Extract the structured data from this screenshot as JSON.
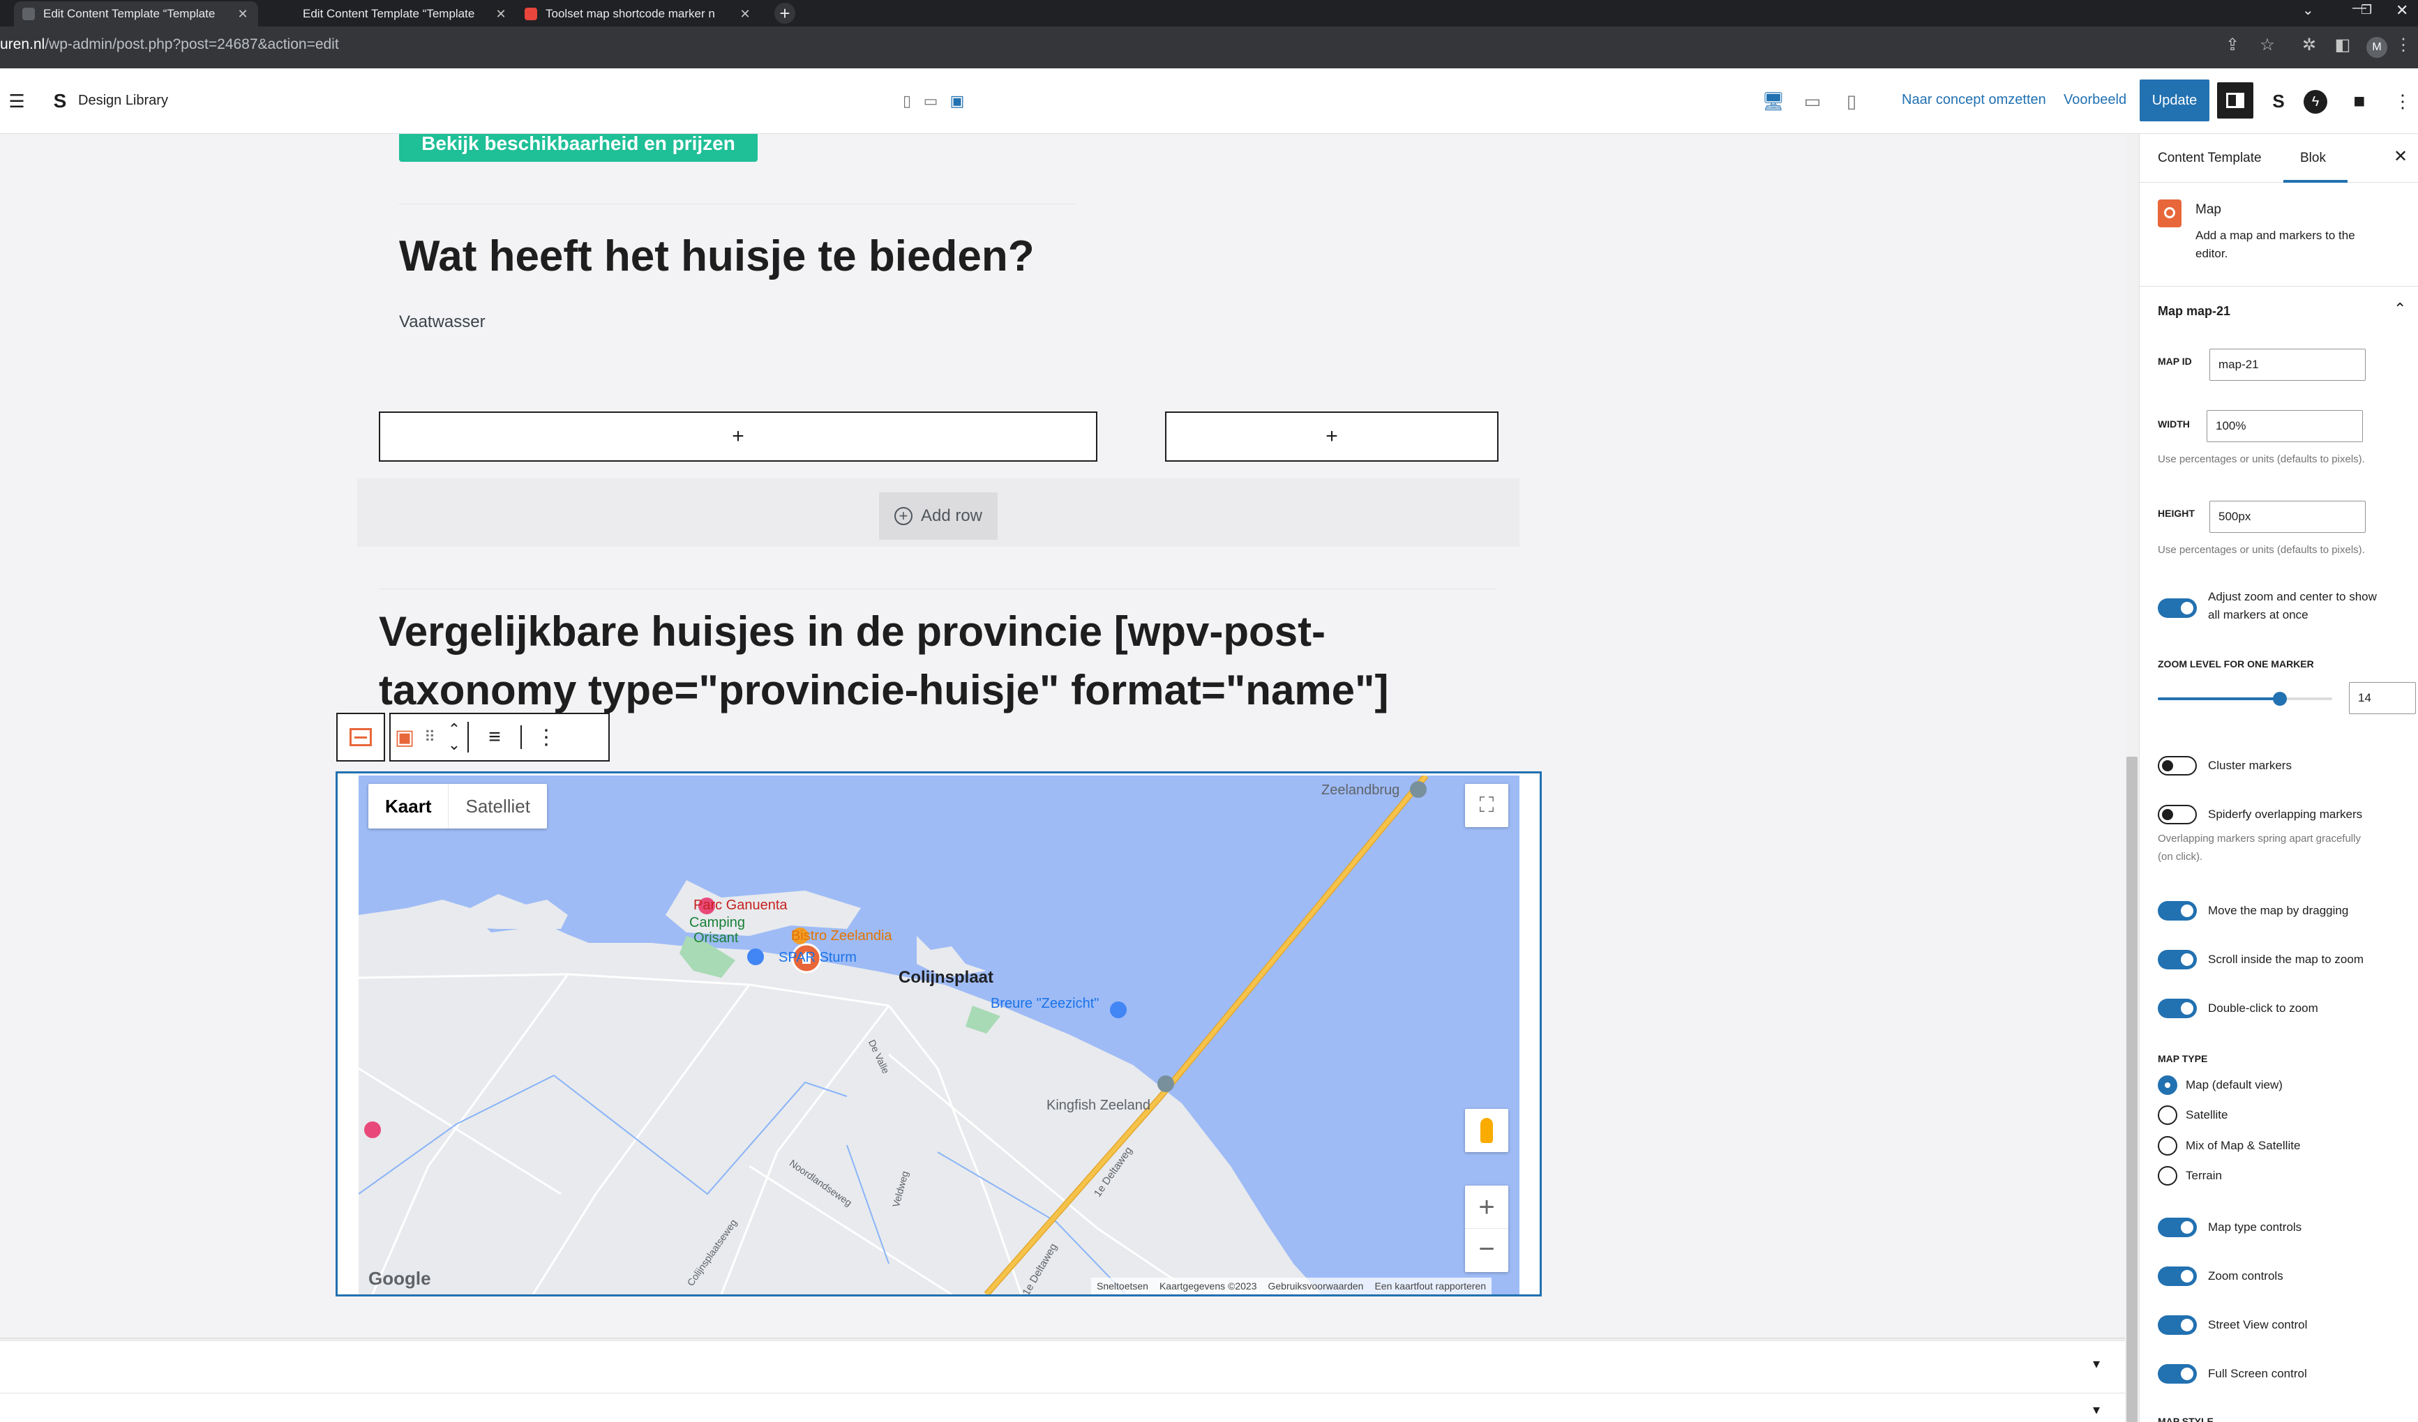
{
  "browser": {
    "tabs": [
      {
        "title": "Edit Content Template “Template"
      },
      {
        "title": "Edit Content Template “Template"
      },
      {
        "title": "Toolset map shortcode marker n"
      }
    ],
    "url_host": "uren.nl",
    "url_path": "/wp-admin/post.php?post=24687&action=edit",
    "profile_initial": "M"
  },
  "editor_header": {
    "site_title": "Design Library",
    "draft_link": "Naar concept omzetten",
    "preview_link": "Voorbeeld",
    "update_button": "Update"
  },
  "content": {
    "cta_button": "Bekijk beschikbaarheid en prijzen",
    "heading1": "Wat heeft het huisje te bieden?",
    "amenity": "Vaatwasser",
    "appender_symbol": "+",
    "add_row_label": "Add row",
    "heading2_line1": "Vergelijkbare huisjes in de provincie [wpv-post-",
    "heading2_line2": "taxonomy type=\"provincie-huisje\" format=\"name\"]"
  },
  "map": {
    "type_buttons": [
      "Kaart",
      "Satelliet"
    ],
    "places": {
      "zeelandbrug": "Zeelandbrug",
      "parc": "Parc Ganuenta",
      "camping1": "Camping",
      "camping2": "Orisant",
      "bistro": "Bistro Zeelandia",
      "spar": "SPAR Sturm",
      "town": "Colijnsplaat",
      "breure": "Breure \"Zeezicht\"",
      "kingfish": "Kingfish Zeeland",
      "deltaweg1": "1e Deltaweg",
      "deltaweg2": "1e Deltaweg",
      "devalle": "De Valle",
      "veldweg": "Veldweg",
      "noordlandseweg": "Noordlandseweg",
      "colijnsplaatseweg": "Colijnsplaatseweg"
    },
    "logo": "Google",
    "footer": [
      "Sneltoetsen",
      "Kaartgegevens ©2023",
      "Gebruiksvoorwaarden",
      "Een kaartfout rapporteren"
    ],
    "colors": {
      "water": "#9ebbf6",
      "land": "#e8eaed",
      "highway": "#f6c34a",
      "pin": "#e8673a"
    }
  },
  "sidebar": {
    "tabs": [
      "Content Template",
      "Blok"
    ],
    "block_name": "Map",
    "block_desc_line1": "Add a map and markers to the",
    "block_desc_line2": "editor.",
    "panel_title": "Map map-21",
    "map_id_label": "MAP ID",
    "map_id_value": "map-21",
    "width_label": "WIDTH",
    "width_value": "100%",
    "width_help": "Use percentages or units (defaults to pixels).",
    "height_label": "HEIGHT",
    "height_value": "500px",
    "height_help": "Use percentages or units (defaults to pixels).",
    "adjust_zoom_line1": "Adjust zoom and center to show",
    "adjust_zoom_line2": "all markers at once",
    "zoom_label": "ZOOM LEVEL FOR ONE MARKER",
    "zoom_value": "14",
    "zoom_fraction": 0.7,
    "cluster": "Cluster markers",
    "spiderfy": "Spiderfy overlapping markers",
    "spiderfy_help_line1": "Overlapping markers spring apart gracefully",
    "spiderfy_help_line2": "(on click).",
    "drag": "Move the map by dragging",
    "scroll_zoom": "Scroll inside the map to zoom",
    "dblclick": "Double-click to zoom",
    "map_type_label": "MAP TYPE",
    "map_types": [
      "Map (default view)",
      "Satellite",
      "Mix of Map & Satellite",
      "Terrain"
    ],
    "map_type_controls": "Map type controls",
    "zoom_controls": "Zoom controls",
    "street_view": "Street View control",
    "full_screen": "Full Screen control",
    "map_style_label": "MAP STYLE"
  }
}
